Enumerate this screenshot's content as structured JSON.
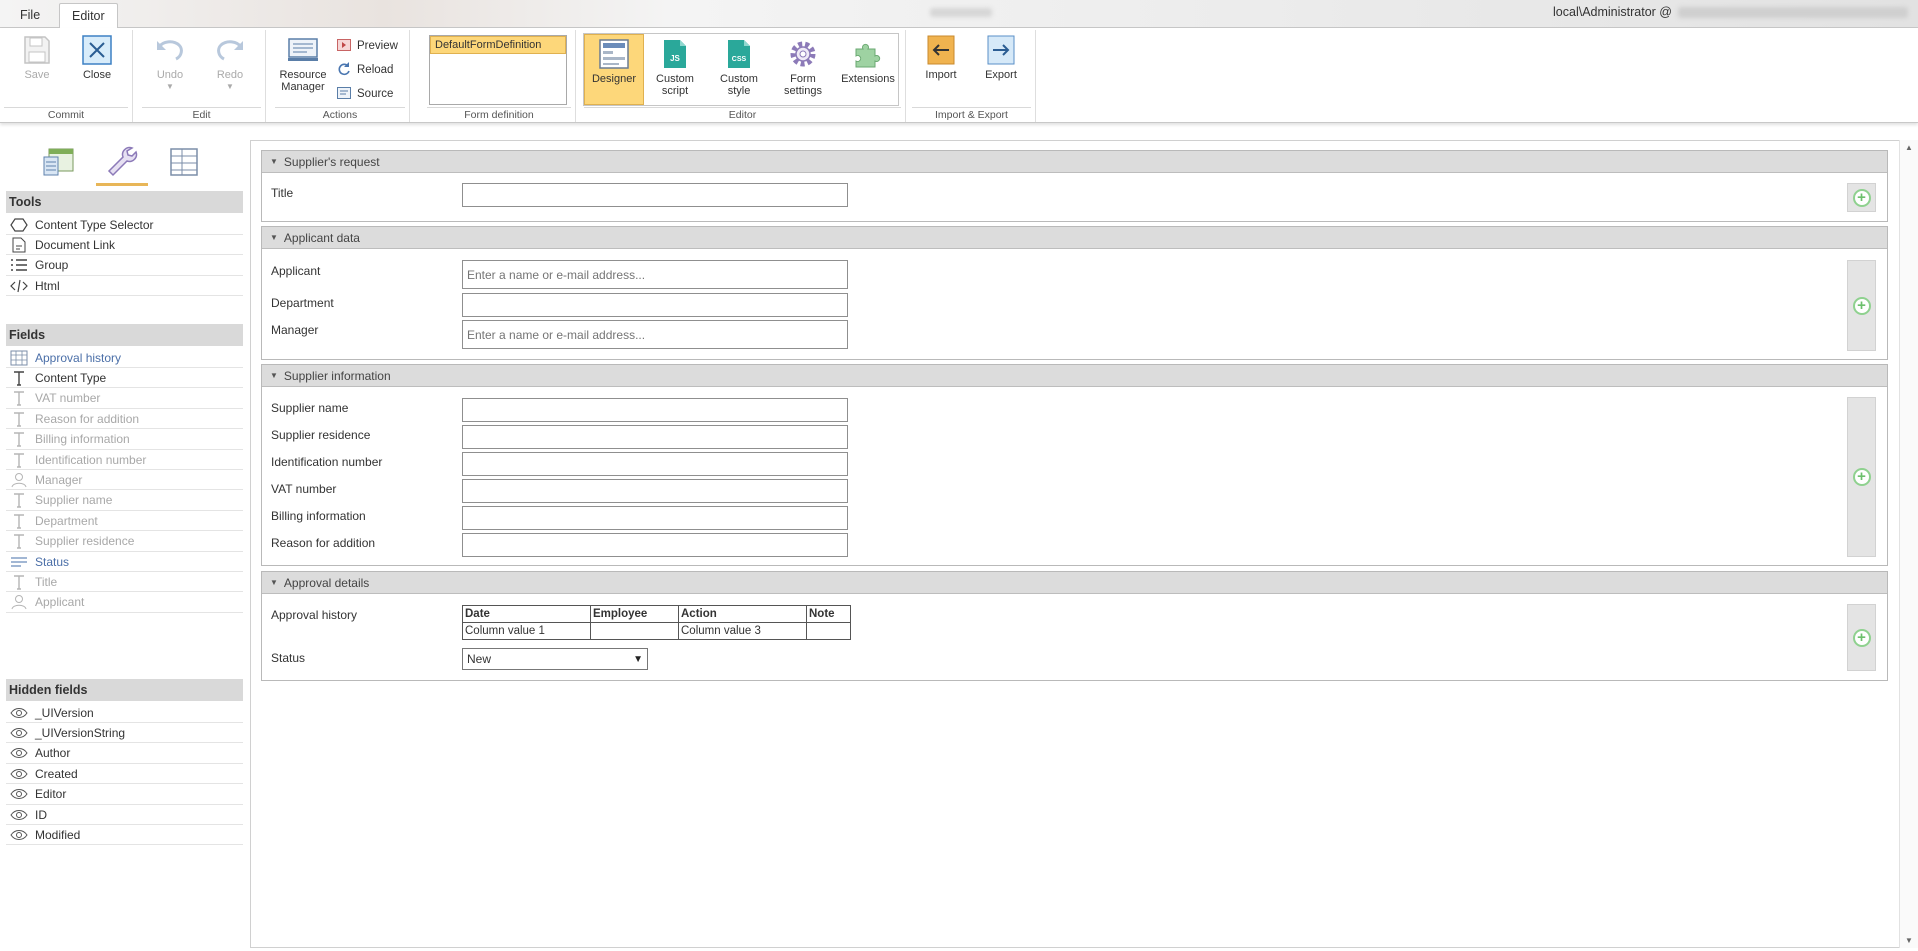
{
  "menu": {
    "file": "File",
    "editor": "Editor"
  },
  "user": {
    "label": "local\\Administrator @"
  },
  "ribbon": {
    "commit": {
      "label": "Commit",
      "save": "Save",
      "close": "Close"
    },
    "edit": {
      "label": "Edit",
      "undo": "Undo",
      "redo": "Redo"
    },
    "actions": {
      "label": "Actions",
      "resource_manager_1": "Resource",
      "resource_manager_2": "Manager",
      "preview": "Preview",
      "reload": "Reload",
      "source": "Source"
    },
    "form_definition": {
      "label": "Form definition",
      "selected": "DefaultFormDefinition"
    },
    "editor": {
      "label": "Editor",
      "designer": "Designer",
      "custom_script_1": "Custom",
      "custom_script_2": "script",
      "custom_style_1": "Custom",
      "custom_style_2": "style",
      "form_settings_1": "Form",
      "form_settings_2": "settings",
      "extensions": "Extensions",
      "js_badge": "JS",
      "css_badge": "CSS"
    },
    "import_export": {
      "label": "Import & Export",
      "import": "Import",
      "export": "Export"
    }
  },
  "left": {
    "tools_header": "Tools",
    "tools": [
      {
        "label": "Content Type Selector",
        "icon": "hexagon-icon"
      },
      {
        "label": "Document Link",
        "icon": "document-link-icon"
      },
      {
        "label": "Group",
        "icon": "list-icon"
      },
      {
        "label": "Html",
        "icon": "code-icon"
      }
    ],
    "fields_header": "Fields",
    "fields": [
      {
        "label": "Approval history",
        "icon": "grid-icon",
        "state": "blue"
      },
      {
        "label": "Content Type",
        "icon": "text-icon",
        "state": "normal"
      },
      {
        "label": "VAT number",
        "icon": "text-icon",
        "state": "dim"
      },
      {
        "label": "Reason for addition",
        "icon": "text-icon",
        "state": "dim"
      },
      {
        "label": "Billing information",
        "icon": "text-icon",
        "state": "dim"
      },
      {
        "label": "Identification number",
        "icon": "text-icon",
        "state": "dim"
      },
      {
        "label": "Manager",
        "icon": "user-icon",
        "state": "dim"
      },
      {
        "label": "Supplier name",
        "icon": "text-icon",
        "state": "dim"
      },
      {
        "label": "Department",
        "icon": "text-icon",
        "state": "dim"
      },
      {
        "label": "Supplier residence",
        "icon": "text-icon",
        "state": "dim"
      },
      {
        "label": "Status",
        "icon": "choice-icon",
        "state": "blue"
      },
      {
        "label": "Title",
        "icon": "text-icon",
        "state": "dim"
      },
      {
        "label": "Applicant",
        "icon": "user-icon",
        "state": "dim"
      }
    ],
    "hidden_header": "Hidden fields",
    "hidden": [
      {
        "label": "_UIVersion"
      },
      {
        "label": "_UIVersionString"
      },
      {
        "label": "Author"
      },
      {
        "label": "Created"
      },
      {
        "label": "Editor"
      },
      {
        "label": "ID"
      },
      {
        "label": "Modified"
      }
    ]
  },
  "form": {
    "s1": {
      "title": "Supplier's request",
      "title_label": "Title"
    },
    "s2": {
      "title": "Applicant data",
      "applicant": "Applicant",
      "applicant_ph": "Enter a name or e-mail address...",
      "department": "Department",
      "manager": "Manager",
      "manager_ph": "Enter a name or e-mail address..."
    },
    "s3": {
      "title": "Supplier information",
      "supplier_name": "Supplier name",
      "supplier_residence": "Supplier residence",
      "identification_number": "Identification number",
      "vat_number": "VAT number",
      "billing_information": "Billing information",
      "reason_for_addition": "Reason for addition"
    },
    "s4": {
      "title": "Approval details",
      "approval_history": "Approval history",
      "table": {
        "headers": [
          "Date",
          "Employee",
          "Action",
          "Note"
        ],
        "row": [
          "Column value 1",
          "",
          "Column value 3",
          ""
        ]
      },
      "status": "Status",
      "status_value": "New"
    }
  },
  "colors": {
    "accent": "#e8b658",
    "selected": "#fdd77a",
    "add": "#8fd18f",
    "link": "#4b6fa8"
  }
}
